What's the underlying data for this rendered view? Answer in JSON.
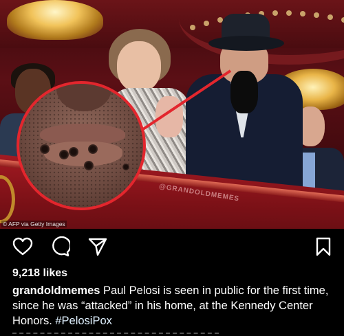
{
  "photo": {
    "watermark": "@GRANDOLDMEMES",
    "credit": "© AFP via Getty Images"
  },
  "actions": {
    "like_icon": "heart-icon",
    "comment_icon": "comment-icon",
    "share_icon": "send-icon",
    "save_icon": "bookmark-icon"
  },
  "post": {
    "likes": "9,218 likes",
    "username": "grandoldmemes",
    "caption": " Paul Pelosi is seen in public for the first time, since he was “attacked” in his home, at the Kennedy Center Honors. ",
    "hashtag": "#PelosiPox"
  },
  "colors": {
    "background": "#000000",
    "highlight_ring": "#e3262d",
    "text": "#ffffff"
  }
}
